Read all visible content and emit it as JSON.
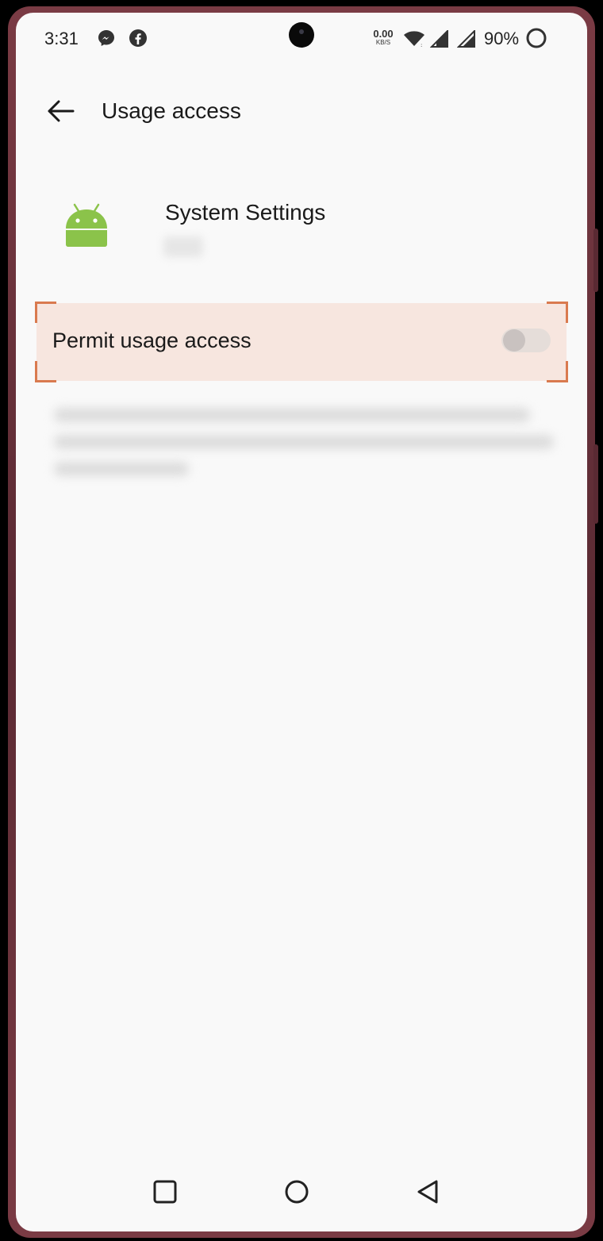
{
  "status_bar": {
    "time": "3:31",
    "net_speed_value": "0.00",
    "net_speed_unit": "KB/S",
    "battery": "90%",
    "icons": [
      "messenger-icon",
      "facebook-icon",
      "wifi-icon",
      "signal-icon",
      "battery-ring-icon"
    ]
  },
  "header": {
    "title": "Usage access",
    "back_icon": "arrow-left-icon"
  },
  "app": {
    "name": "System Settings",
    "icon": "android-icon",
    "icon_color": "#8bc34a"
  },
  "permission": {
    "label": "Permit usage access",
    "enabled": false,
    "highlight_color": "#f7e6df",
    "accent_color": "#d97a4f"
  },
  "nav_bar": {
    "icons": [
      "recent-apps-icon",
      "home-icon",
      "back-triangle-icon"
    ]
  }
}
